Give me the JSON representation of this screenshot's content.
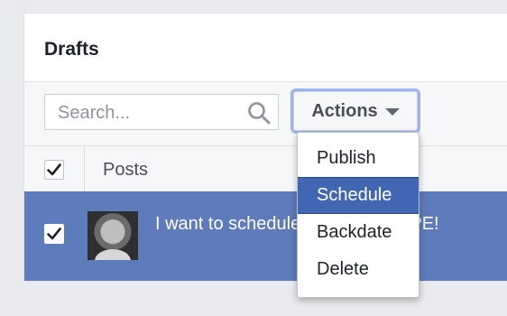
{
  "panel": {
    "title": "Drafts"
  },
  "toolbar": {
    "search_placeholder": "Search...",
    "actions_label": "Actions"
  },
  "table": {
    "header": {
      "posts_label": "Posts",
      "select_all_checked": true
    },
    "rows": [
      {
        "checked": true,
        "text": "I want to schedule this post. NOPE!"
      }
    ]
  },
  "actions_menu": {
    "items": [
      {
        "label": "Publish",
        "active": false
      },
      {
        "label": "Schedule",
        "active": true
      },
      {
        "label": "Backdate",
        "active": false
      },
      {
        "label": "Delete",
        "active": false
      }
    ]
  },
  "colors": {
    "selected_row": "#5e7bbb",
    "menu_highlight": "#4267b2",
    "focus_ring": "#9cb4f5"
  },
  "icons": {
    "search": "search-icon",
    "caret": "caret-down-icon",
    "check": "checkmark-icon"
  }
}
